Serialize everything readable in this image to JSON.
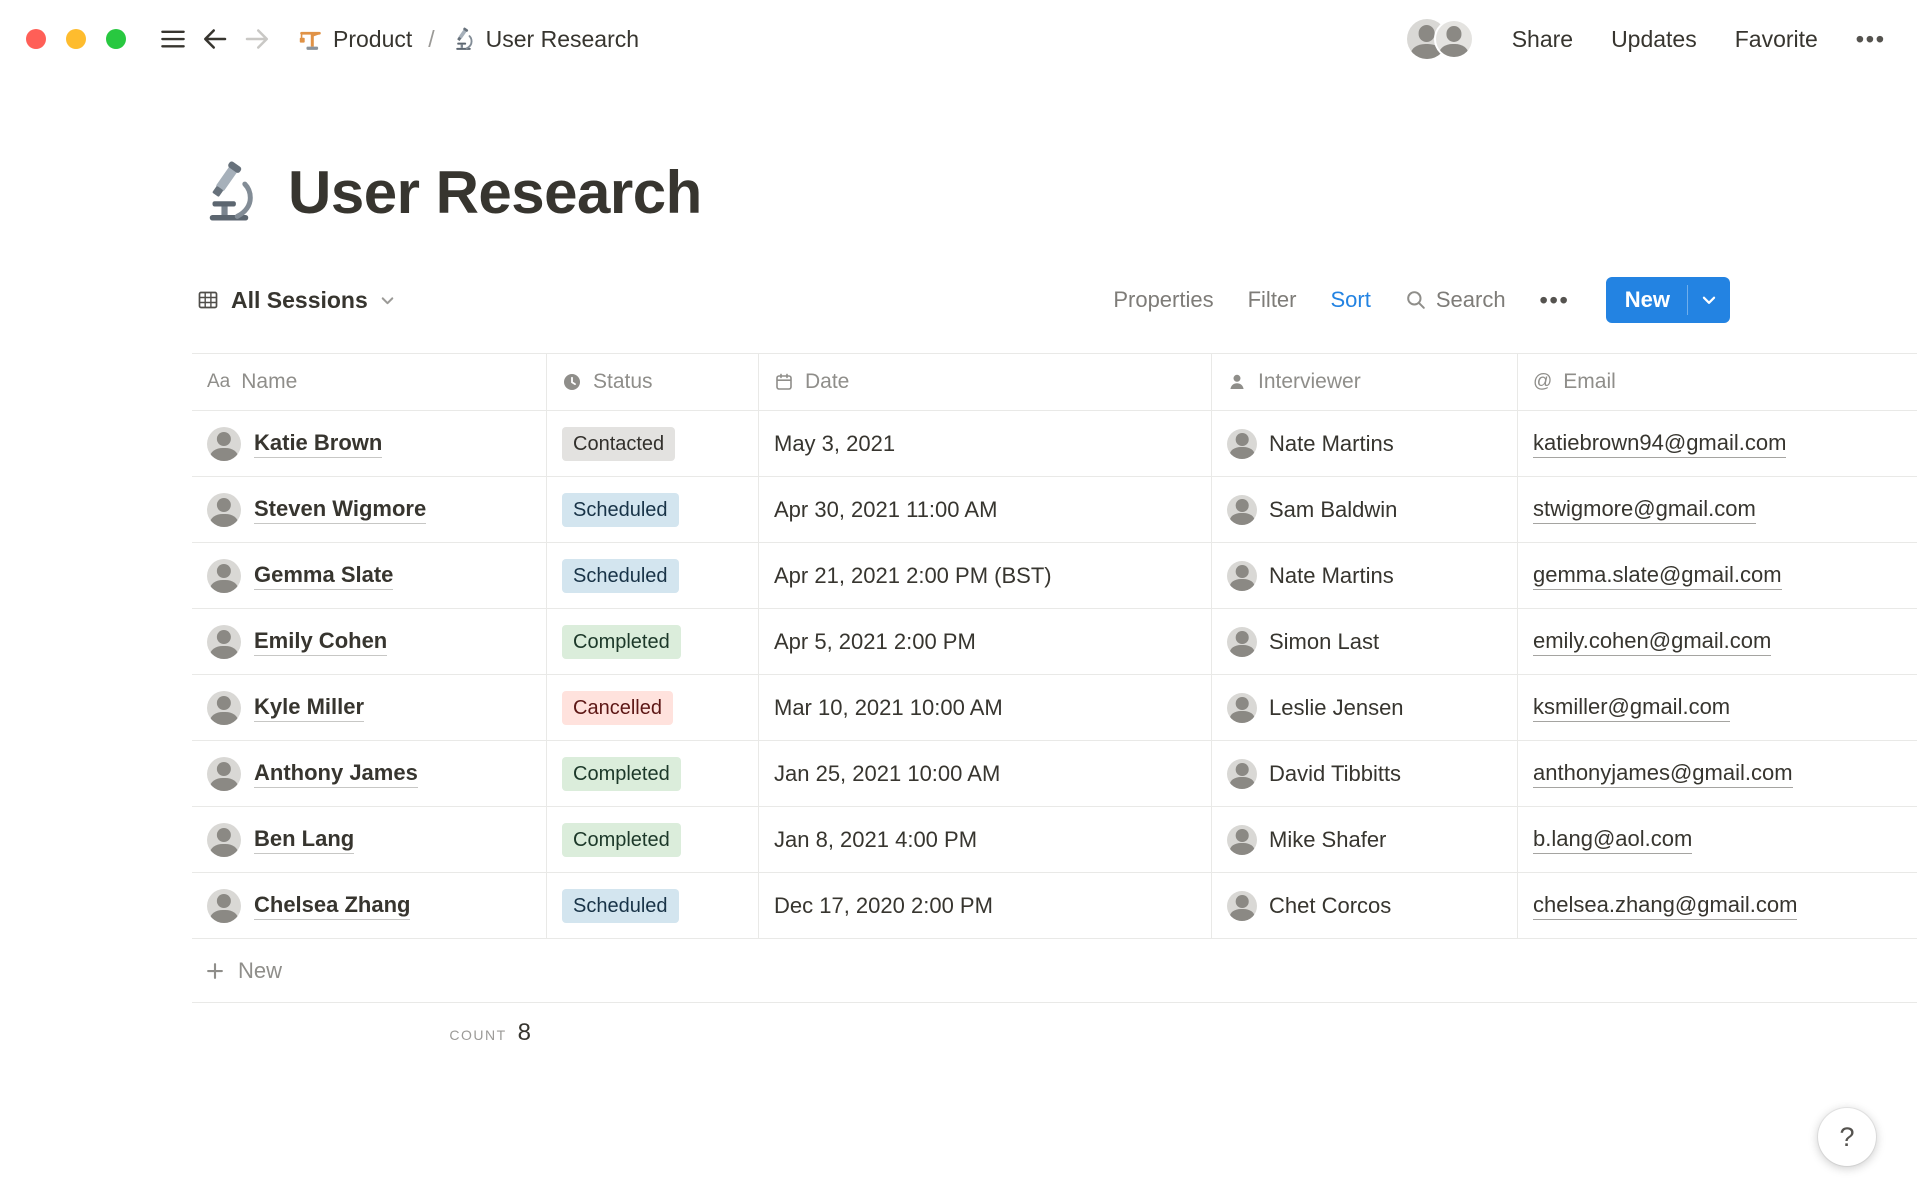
{
  "topbar": {
    "breadcrumb": {
      "root_label": "Product",
      "separator": "/",
      "current_label": "User Research"
    },
    "share_label": "Share",
    "updates_label": "Updates",
    "favorite_label": "Favorite",
    "more_label": "•••"
  },
  "page": {
    "title": "User Research",
    "icon": "microscope-icon"
  },
  "toolbar": {
    "view_label": "All Sessions",
    "properties_label": "Properties",
    "filter_label": "Filter",
    "sort_label": "Sort",
    "search_label": "Search",
    "more_label": "•••",
    "new_label": "New"
  },
  "table": {
    "columns": [
      {
        "label": "Name",
        "icon": "text-icon",
        "glyph": "Aa"
      },
      {
        "label": "Status",
        "icon": "status-icon"
      },
      {
        "label": "Date",
        "icon": "calendar-icon"
      },
      {
        "label": "Interviewer",
        "icon": "person-icon"
      },
      {
        "label": "Email",
        "icon": "at-icon",
        "glyph": "@"
      }
    ],
    "rows": [
      {
        "name": "Katie Brown",
        "status": "Contacted",
        "status_color": "gray",
        "date": "May 3, 2021",
        "interviewer": "Nate Martins",
        "email": "katiebrown94@gmail.com"
      },
      {
        "name": "Steven Wigmore",
        "status": "Scheduled",
        "status_color": "blue",
        "date": "Apr 30, 2021 11:00 AM",
        "interviewer": "Sam Baldwin",
        "email": "stwigmore@gmail.com"
      },
      {
        "name": "Gemma Slate",
        "status": "Scheduled",
        "status_color": "blue",
        "date": "Apr 21, 2021 2:00 PM (BST)",
        "interviewer": "Nate Martins",
        "email": "gemma.slate@gmail.com"
      },
      {
        "name": "Emily Cohen",
        "status": "Completed",
        "status_color": "green",
        "date": "Apr 5, 2021 2:00 PM",
        "interviewer": "Simon Last",
        "email": "emily.cohen@gmail.com"
      },
      {
        "name": "Kyle Miller",
        "status": "Cancelled",
        "status_color": "red",
        "date": "Mar 10, 2021 10:00 AM",
        "interviewer": "Leslie Jensen",
        "email": "ksmiller@gmail.com"
      },
      {
        "name": "Anthony James",
        "status": "Completed",
        "status_color": "green",
        "date": "Jan 25, 2021 10:00 AM",
        "interviewer": "David Tibbitts",
        "email": "anthonyjames@gmail.com"
      },
      {
        "name": "Ben Lang",
        "status": "Completed",
        "status_color": "green",
        "date": "Jan 8, 2021 4:00 PM",
        "interviewer": "Mike Shafer",
        "email": "b.lang@aol.com"
      },
      {
        "name": "Chelsea Zhang",
        "status": "Scheduled",
        "status_color": "blue",
        "date": "Dec 17, 2020 2:00 PM",
        "interviewer": "Chet Corcos",
        "email": "chelsea.zhang@gmail.com"
      }
    ],
    "new_row_label": "New",
    "footer": {
      "count_label": "COUNT",
      "count_value": "8"
    }
  },
  "help_label": "?",
  "colors": {
    "accent_blue": "#2383e2",
    "status_gray_bg": "#e3e2e0",
    "status_blue_bg": "#d3e5ef",
    "status_green_bg": "#dbeddb",
    "status_red_bg": "#ffe2dd"
  }
}
